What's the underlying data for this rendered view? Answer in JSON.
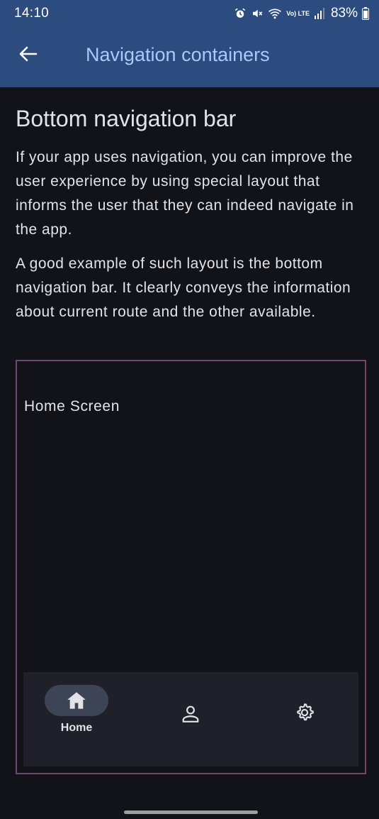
{
  "status_bar": {
    "time": "14:10",
    "battery_percent": "83%",
    "network_label": "Vo) LTE",
    "icons": [
      "alarm-icon",
      "mute-icon",
      "wifi-icon",
      "signal-icon",
      "battery-icon"
    ]
  },
  "app_bar": {
    "back_icon": "arrow-back-icon",
    "title": "Navigation containers"
  },
  "content": {
    "section_title": "Bottom navigation bar",
    "paragraph_1": "If your app uses navigation, you can improve the user experience by using special layout that informs the user that they can indeed navigate in the app.",
    "paragraph_2": "A good example of such layout is the bottom navigation bar. It clearly conveys the information about current route and the other available."
  },
  "demo": {
    "screen_label": "Home Screen",
    "nav_items": [
      {
        "icon": "home-icon",
        "label": "Home",
        "selected": true
      },
      {
        "icon": "person-icon",
        "label": "",
        "selected": false
      },
      {
        "icon": "gear-icon",
        "label": "",
        "selected": false
      }
    ]
  },
  "colors": {
    "app_bar_bg": "#2c4b7e",
    "app_bar_title": "#a8c8ff",
    "background": "#121318",
    "text": "#e4e2e9",
    "frame_border": "#6e4a6e",
    "nav_bg": "#1f2029",
    "nav_indicator": "#3d4455"
  }
}
